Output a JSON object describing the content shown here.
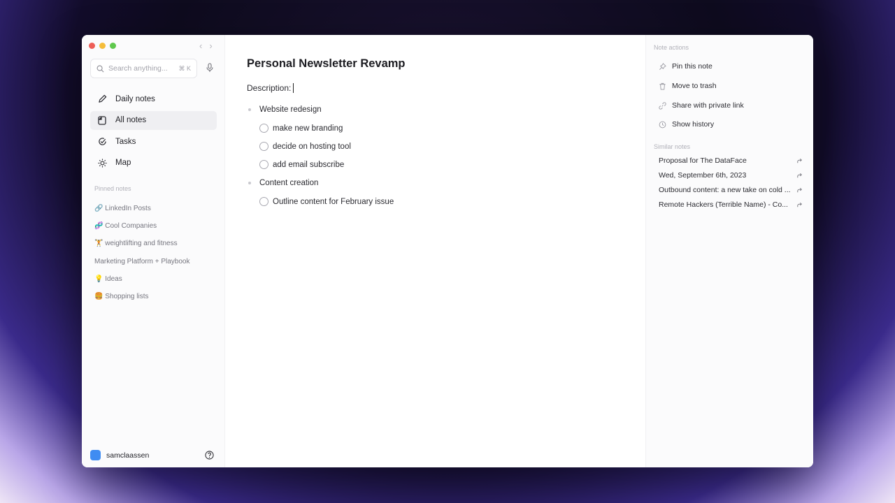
{
  "window": {
    "controls": [
      "close",
      "minimize",
      "maximize"
    ]
  },
  "sidebar": {
    "search": {
      "placeholder": "Search anything...",
      "shortcut": "⌘ K"
    },
    "menu": [
      {
        "label": "Daily notes",
        "icon": "pencil-icon",
        "active": false
      },
      {
        "label": "All notes",
        "icon": "notes-icon",
        "active": true
      },
      {
        "label": "Tasks",
        "icon": "check-circle-icon",
        "active": false
      },
      {
        "label": "Map",
        "icon": "sun-icon",
        "active": false
      }
    ],
    "pinned_title": "Pinned notes",
    "pinned": [
      "🔗 LinkedIn Posts",
      "🧬 Cool Companies",
      "🏋 weightlifting and fitness",
      "Marketing Platform + Playbook",
      "💡 Ideas",
      "🍔 Shopping lists"
    ],
    "user": "samclaassen"
  },
  "note": {
    "title": "Personal Newsletter Revamp",
    "description_label": "Description:",
    "sections": [
      {
        "label": "Website redesign",
        "tasks": [
          "make new branding",
          "decide on hosting tool",
          "add email subscribe"
        ]
      },
      {
        "label": "Content creation",
        "tasks": [
          "Outline content for February issue"
        ]
      }
    ]
  },
  "right_panel": {
    "actions_title": "Note actions",
    "actions": [
      {
        "label": "Pin this note",
        "icon": "pin-icon"
      },
      {
        "label": "Move to trash",
        "icon": "trash-icon"
      },
      {
        "label": "Share with private link",
        "icon": "link-icon"
      },
      {
        "label": "Show history",
        "icon": "clock-icon"
      }
    ],
    "similar_title": "Similar notes",
    "similar": [
      "Proposal for The DataFace",
      "Wed, September 6th, 2023",
      "Outbound content: a new take on cold ...",
      "Remote Hackers (Terrible Name) - Co..."
    ]
  },
  "colors": {
    "accent": "#3f8cf2",
    "active_bg": "#efeff2"
  }
}
